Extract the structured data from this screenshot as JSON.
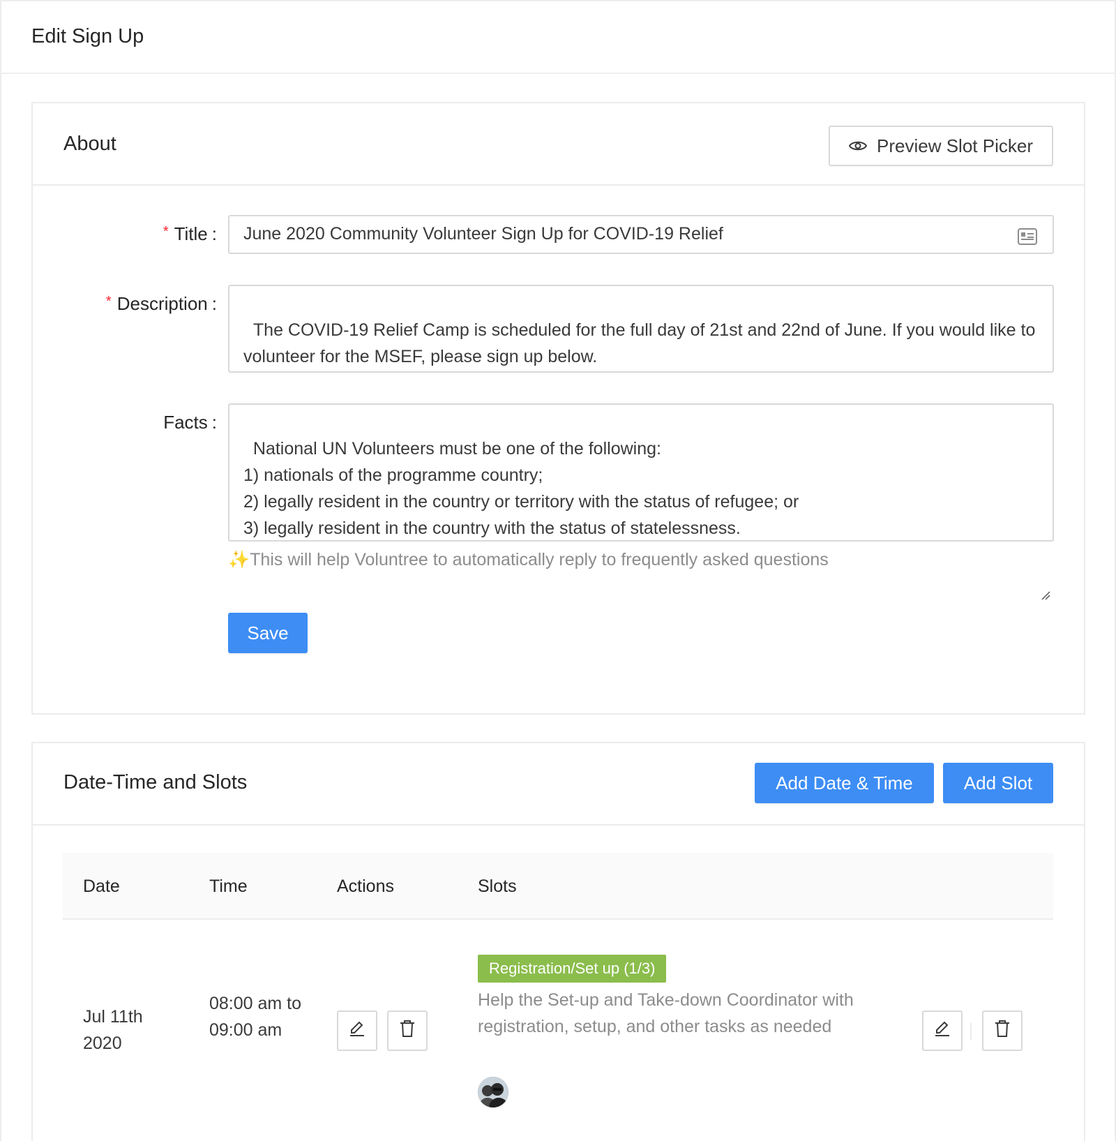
{
  "header": {
    "title": "Edit Sign Up"
  },
  "about": {
    "title": "About",
    "preview_button": "Preview Slot Picker",
    "fields": {
      "title_label": "Title",
      "title_value": "June 2020 Community Volunteer Sign Up for COVID-19 Relief",
      "description_label": "Description",
      "description_value": "The COVID-19 Relief Camp is scheduled for the full day of 21st and 22nd of June. If you would like to volunteer for the MSEF, please sign up below.",
      "facts_label": "Facts",
      "facts_value": "National UN Volunteers must be one of the following:\n1) nationals of the programme country;\n2) legally resident in the country or territory with the status of refugee; or\n3) legally resident in the country with the status of statelessness."
    },
    "colon": ":",
    "required_mark": "*",
    "hint_emoji": "✨",
    "hint": "This will help Voluntree to automatically reply to frequently asked questions",
    "save_button": "Save"
  },
  "slots_section": {
    "title": "Date-Time and Slots",
    "add_datetime_button": "Add Date & Time",
    "add_slot_button": "Add Slot",
    "columns": [
      "Date",
      "Time",
      "Actions",
      "Slots"
    ],
    "rows": [
      {
        "date": "Jul 11th 2020",
        "time": "08:00 am to 09:00 am",
        "slot_tag": "Registration/Set up (1/3)",
        "slot_description": "Help the Set-up and Take-down Coordinator with registration, setup, and other tasks as needed"
      }
    ]
  },
  "colors": {
    "primary": "#3d8df5",
    "tag_green": "#8bbd4c",
    "required": "#f5222d"
  }
}
